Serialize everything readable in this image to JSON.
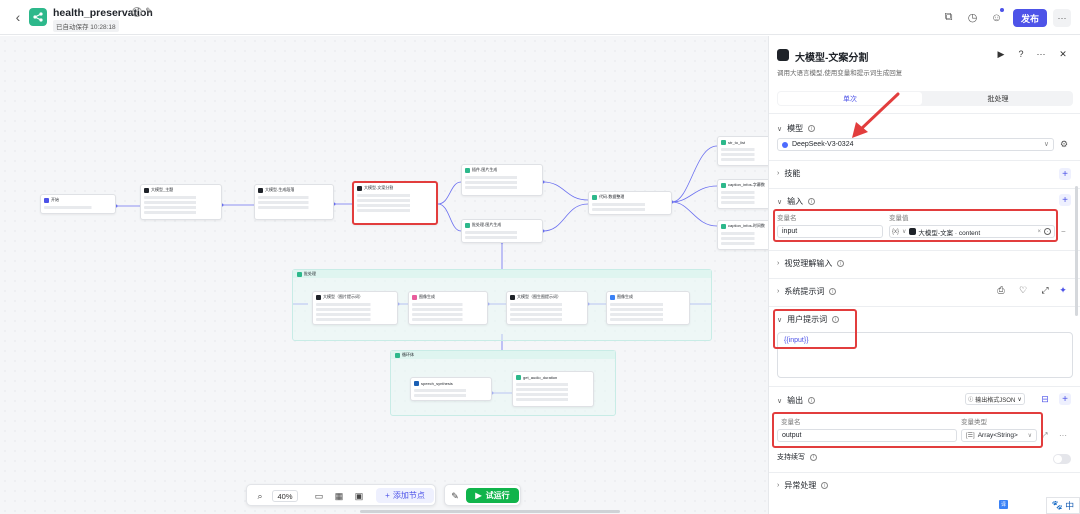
{
  "app": {
    "name": "health_preservation",
    "save_status": "已自动保存 10:28:18",
    "publish_label": "发布",
    "more_label": "···"
  },
  "canvas": {
    "nodes": {
      "start": "开始",
      "llm_topic": "大模型_主题",
      "llm_generate": "大模型-生成段落",
      "llm_split": "大模型-文案分割",
      "gen_image1": "插件-图片生成",
      "gen_image2": "批处理-图片生成",
      "code_merge": "代码-数据整理",
      "caption1": "str_to_list",
      "caption2": "caption_infos-字幕数",
      "caption3": "caption_infos-时间数"
    },
    "batch_group": {
      "title": "批处理",
      "nodes": [
        "大模型（图片提示词）",
        "图像生成",
        "大模型（图生图提示词）",
        "图像生成"
      ]
    },
    "loop_group": {
      "title": "循环体",
      "nodes": [
        "speech_synthesis",
        "get_audio_duration"
      ]
    }
  },
  "toolbar": {
    "zoom": "40%",
    "add_node": "添加节点",
    "test_run": "试运行"
  },
  "panel": {
    "title": "大模型-文案分割",
    "subtitle": "调用大语言模型,使用变量和提示词生成回复",
    "tab_single": "单次",
    "tab_batch": "批处理",
    "section_model": "模型",
    "model_value": "DeepSeek-V3-0324",
    "section_skill": "技能",
    "section_input": "输入",
    "col_var_name": "变量名",
    "col_var_value": "变量值",
    "input_name": "input",
    "input_ref_type": "{x}",
    "input_ref_value": "大模型-文案 · content",
    "section_vision": "视觉理解输入",
    "section_system": "系统提示词",
    "section_user": "用户提示词",
    "user_prompt": "{{input}}",
    "section_output": "输出",
    "output_format": "输出格式JSON",
    "col_out_name": "变量名",
    "col_out_type": "变量类型",
    "output_name": "output",
    "output_type": "Array<String>",
    "stream_label": "支持续写",
    "section_error": "异常处理"
  },
  "ime": {
    "label": "中"
  },
  "colors": {
    "accent": "#4d53e8",
    "highlight": "#e23d3d",
    "run_green": "#10b44b"
  }
}
